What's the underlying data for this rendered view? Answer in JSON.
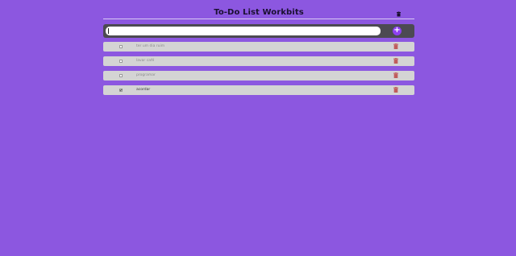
{
  "header": {
    "title": "To-Do List Workbits",
    "icon": "trash-icon"
  },
  "input": {
    "value": "",
    "placeholder": "",
    "add_label": "+",
    "add_icon": "plus-icon"
  },
  "tasks": [
    {
      "label": "ter um dia ruim",
      "completed": false
    },
    {
      "label": "lavar café",
      "completed": false
    },
    {
      "label": "programar",
      "completed": false
    },
    {
      "label": "acordar",
      "completed": true
    }
  ],
  "colors": {
    "background": "#8c57e0",
    "input_bar": "#4c4a52",
    "add_button": "#8e3ff2",
    "row": "#d4d4d4",
    "delete_icon": "#c05c5c"
  }
}
